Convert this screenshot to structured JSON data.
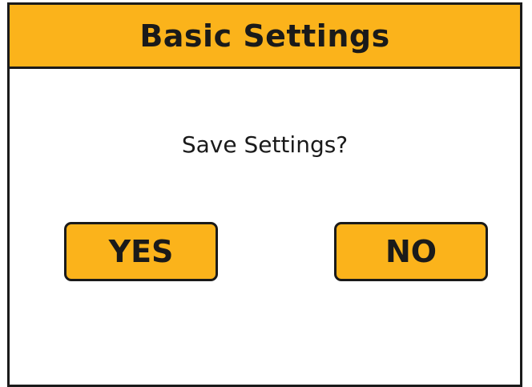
{
  "dialog": {
    "title": "Basic Settings",
    "prompt": "Save Settings?",
    "yes_label": "YES",
    "no_label": "NO"
  },
  "colors": {
    "accent": "#fbb31b",
    "border": "#1a1a1a",
    "background": "#ffffff"
  }
}
